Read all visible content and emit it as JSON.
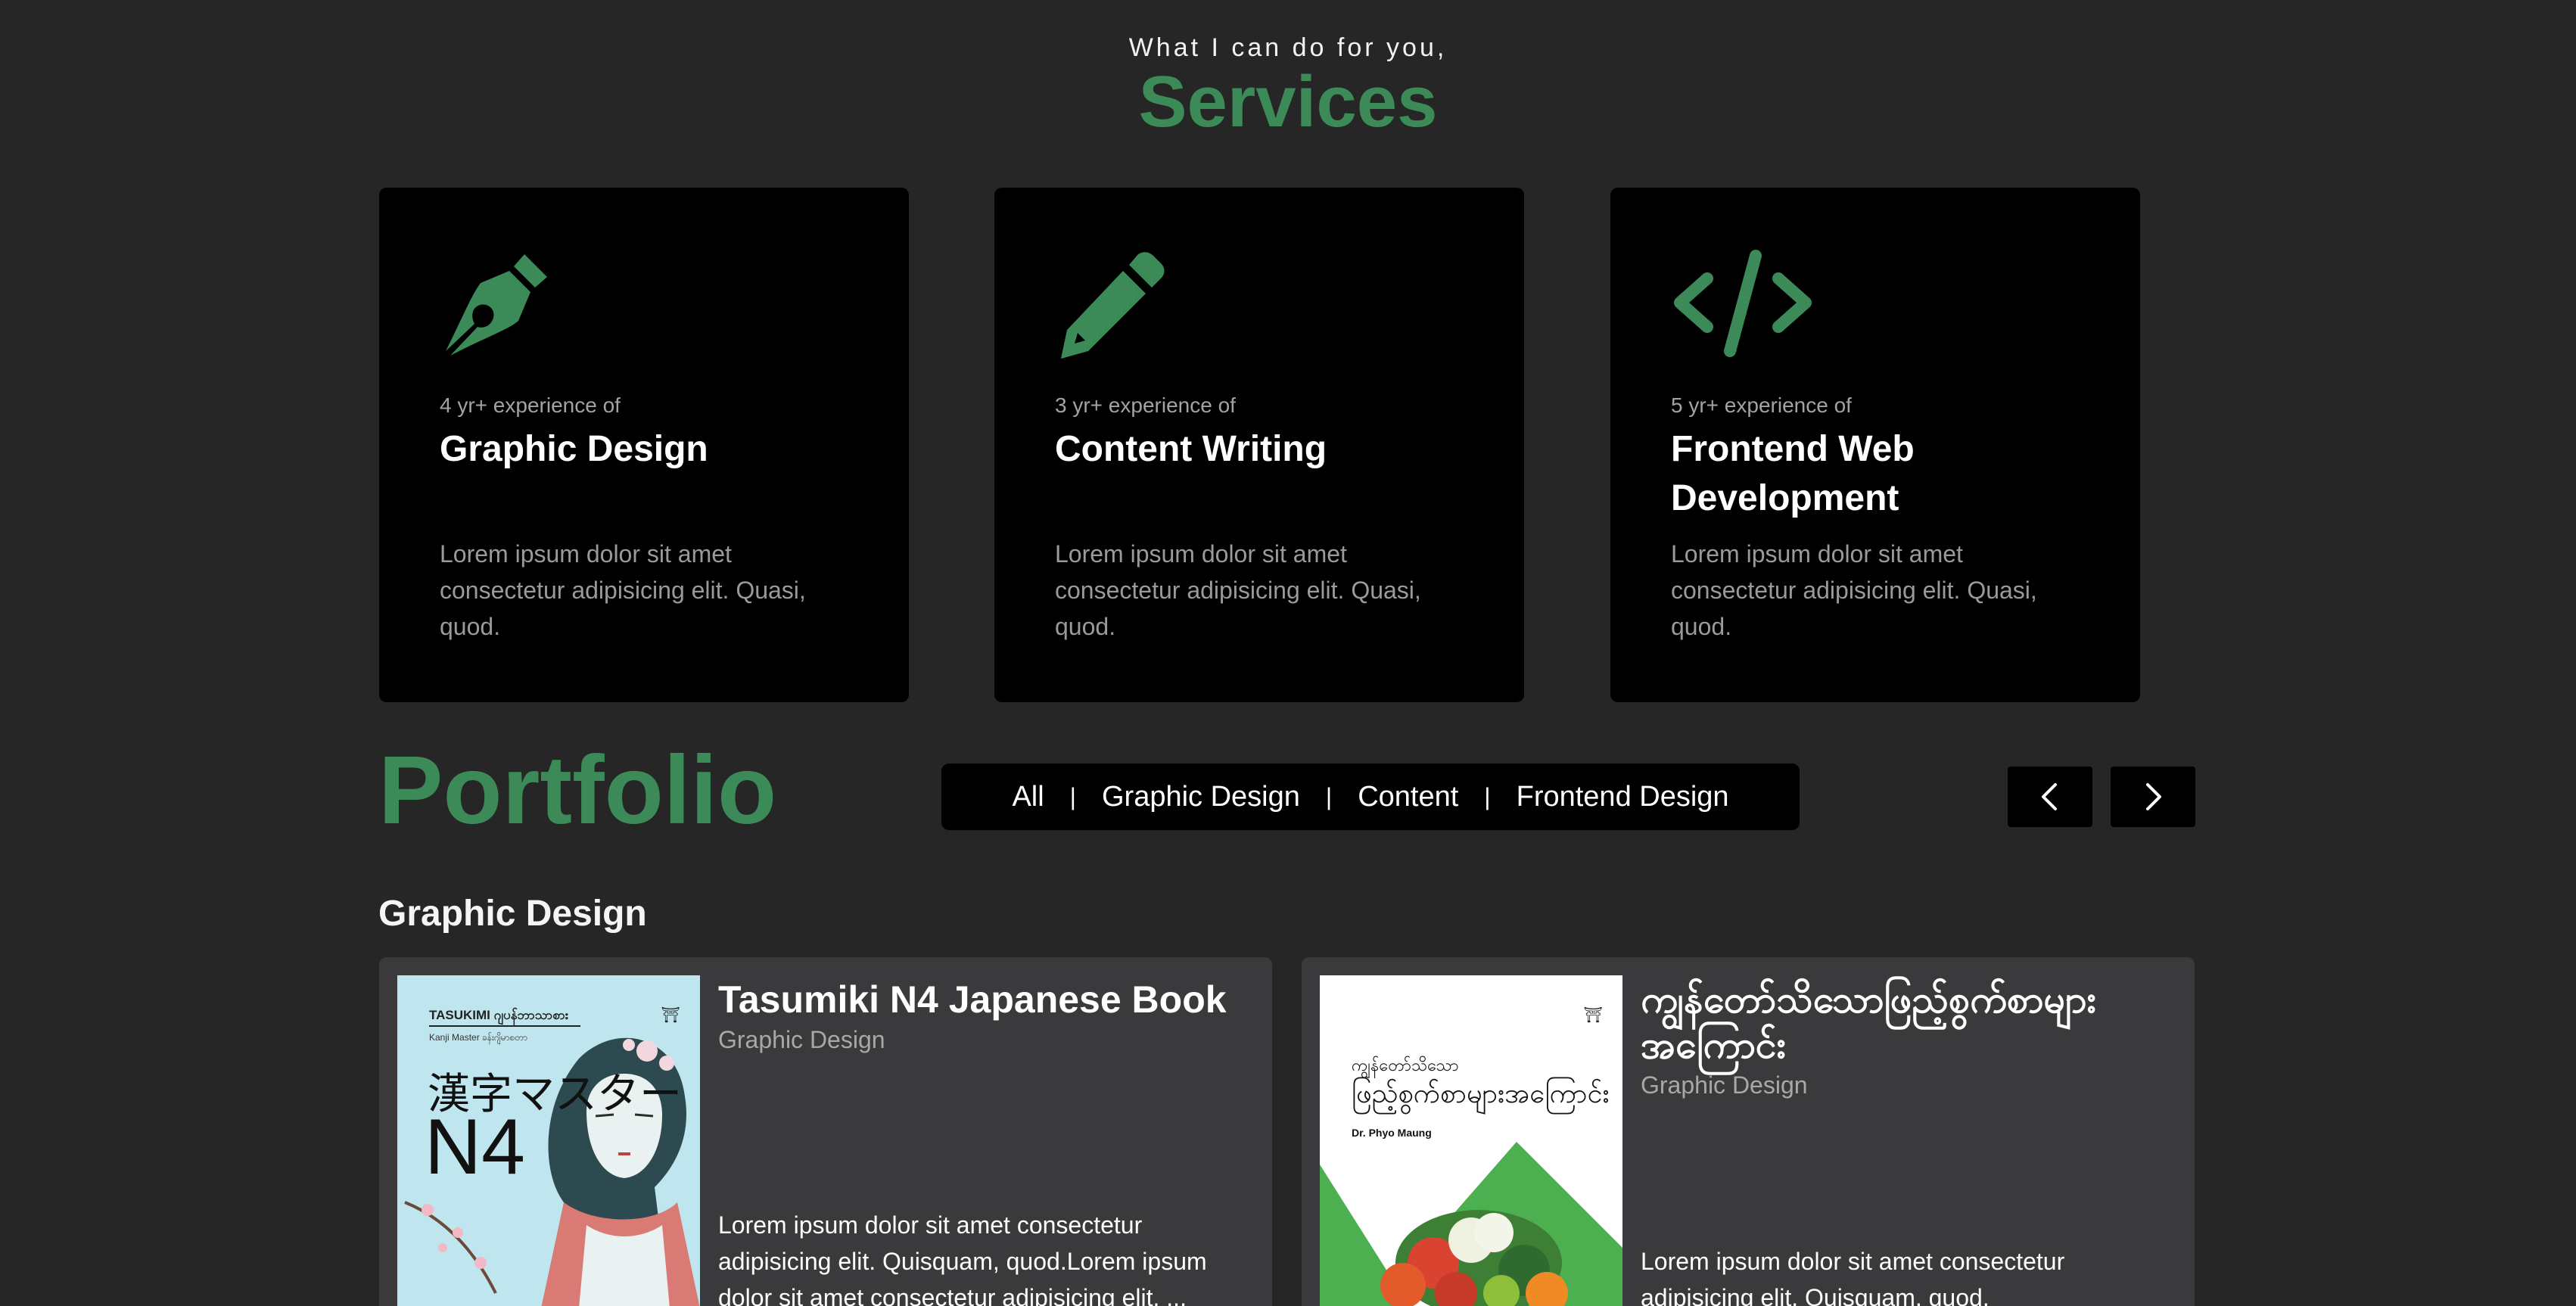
{
  "services": {
    "subtitle": "What I can do for you,",
    "title": "Services",
    "cards": [
      {
        "icon": "pen-nib-icon",
        "experience": "4 yr+ experience of",
        "title": "Graphic Design",
        "description": "Lorem ipsum dolor sit amet consectetur adipisicing elit. Quasi, quod."
      },
      {
        "icon": "pencil-icon",
        "experience": "3 yr+ experience of",
        "title": "Content Writing",
        "description": "Lorem ipsum dolor sit amet consectetur adipisicing elit. Quasi, quod."
      },
      {
        "icon": "code-icon",
        "experience": "5 yr+ experience of",
        "title": "Frontend Web Development",
        "description": "Lorem ipsum dolor sit amet consectetur adipisicing elit. Quasi, quod."
      }
    ]
  },
  "portfolio": {
    "title": "Portfolio",
    "filters": [
      "All",
      "Graphic Design",
      "Content",
      "Frontend Design"
    ],
    "separator": "|",
    "section_label": "Graphic Design",
    "items": [
      {
        "title": "Tasumiki N4 Japanese Book",
        "category": "Graphic Design",
        "description": "Lorem ipsum dolor sit amet consectetur adipisicing elit. Quisquam, quod.Lorem ipsum dolor sit amet consectetur adipisicing elit. ...",
        "cover": {
          "brand": "TASUKIMI ဂျပန်ဘာသာစား",
          "brand_sub": "Kanji Master ခန်းဂျိမာစတာ",
          "kanji": "漢字マスター",
          "level": "N4"
        }
      },
      {
        "title": "ကျွန်တော်သိသောဖြည့်စွက်စာများအကြောင်း",
        "category": "Graphic Design",
        "description": "Lorem ipsum dolor sit amet consectetur adipisicing elit. Quisquam, quod.",
        "cover": {
          "title_line1": "ကျွန်တော်သိသော",
          "title_line2": "ဖြည့်စွက်စာများအကြောင်း",
          "author": "Dr. Phyo Maung"
        }
      }
    ]
  },
  "colors": {
    "background": "#262626",
    "accent": "#3c8a58",
    "card": "#000000",
    "portfolio_card": "#3a3a3d"
  }
}
